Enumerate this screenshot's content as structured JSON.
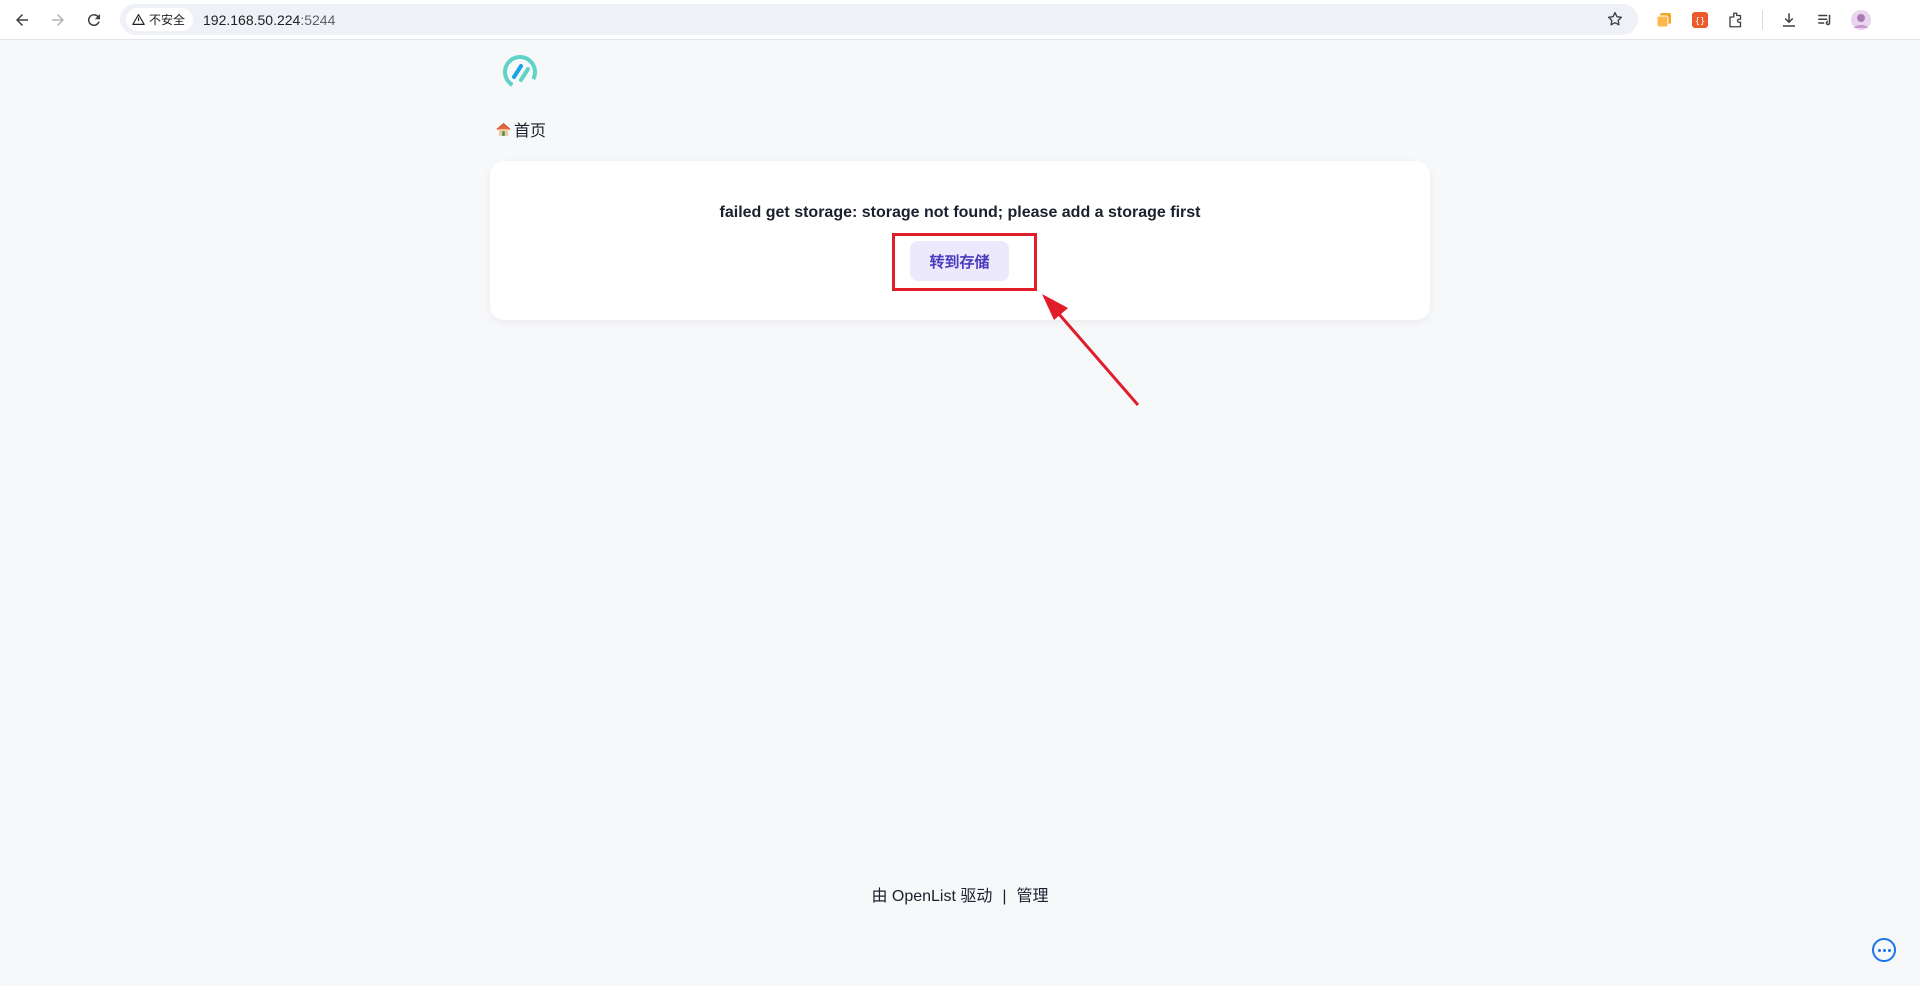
{
  "browser": {
    "security_label": "不安全",
    "url_host": "192.168.50.224",
    "url_port": ":5244"
  },
  "page": {
    "breadcrumb_home": "首页",
    "error_message": "failed get storage: storage not found; please add a storage first",
    "go_storage_label": "转到存储",
    "footer": {
      "powered_prefix": "由 ",
      "brand": "OpenList",
      "powered_suffix": " 驱动",
      "separator": "|",
      "manage": "管理"
    }
  },
  "colors": {
    "accent": "#4c3bbf",
    "button_bg": "#ebe9fb",
    "annotation_red": "#e21d2a",
    "logo_teal": "#5fd3c6",
    "logo_blue": "#1aa3e8"
  },
  "icons": [
    "back-icon",
    "forward-icon",
    "reload-icon",
    "warning-icon",
    "star-icon",
    "home-icon",
    "more-icon"
  ]
}
